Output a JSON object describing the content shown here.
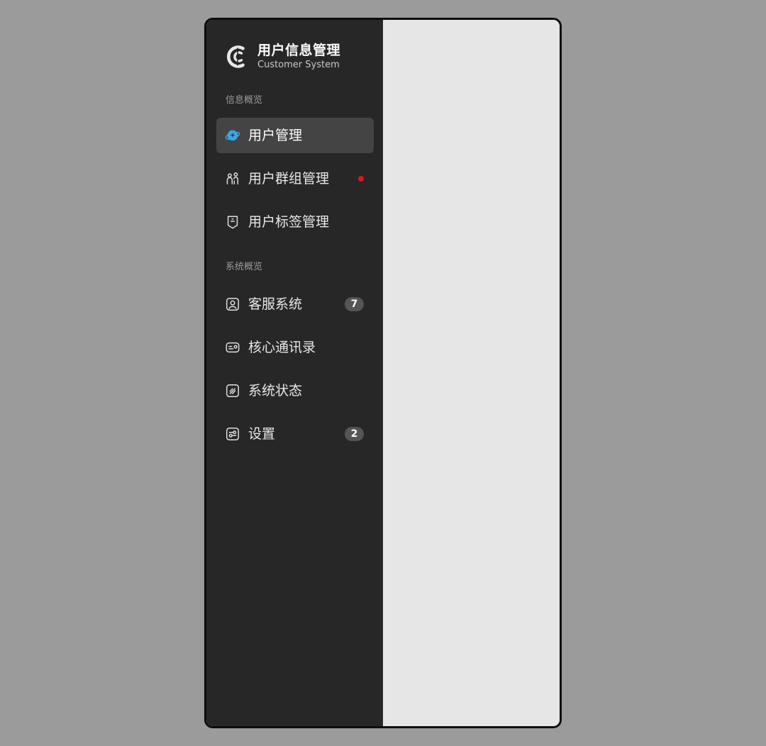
{
  "brand": {
    "title": "用户信息管理",
    "subtitle": "Customer System",
    "logo_icon": "brand-c-logo"
  },
  "sections": {
    "info_overview": "信息概览",
    "system_overview": "系统概览"
  },
  "nav": {
    "user_management": {
      "label": "用户管理",
      "icon": "planet-icon",
      "active": true
    },
    "user_group_management": {
      "label": "用户群组管理",
      "icon": "people-icon",
      "has_notification_dot": true
    },
    "user_tag_management": {
      "label": "用户标签管理",
      "icon": "tag-icon"
    },
    "customer_service": {
      "label": "客服系统",
      "icon": "user-card-icon",
      "badge": "7"
    },
    "core_contacts": {
      "label": "核心通讯录",
      "icon": "contact-card-icon"
    },
    "system_status": {
      "label": "系统状态",
      "icon": "status-icon"
    },
    "settings": {
      "label": "设置",
      "icon": "settings-icon",
      "badge": "2"
    }
  },
  "colors": {
    "sidebar_bg": "#272727",
    "active_item_bg": "#444444",
    "content_bg": "#e6e6e6",
    "page_bg": "#9b9b9b",
    "notification_dot": "#e8101b",
    "planet_blue": "#35a8e6"
  }
}
